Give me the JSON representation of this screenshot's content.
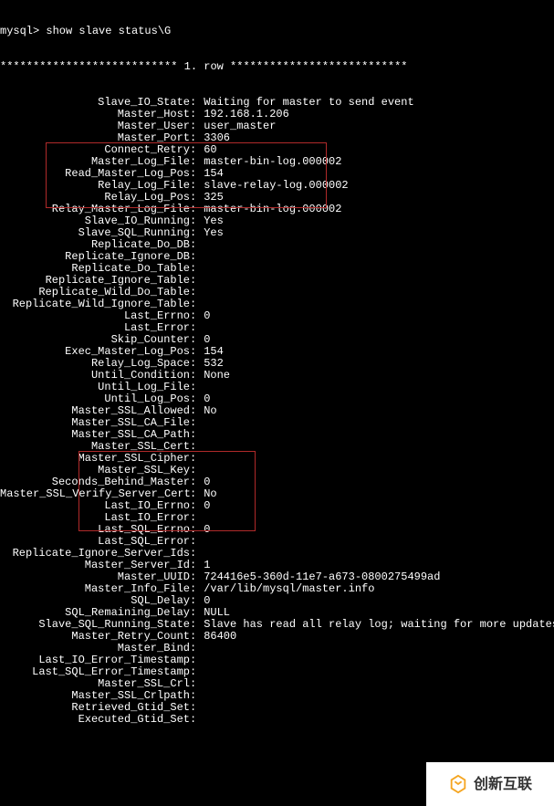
{
  "prompt": "mysql> show slave status\\G",
  "header": "*************************** 1. row ***************************",
  "rows": [
    {
      "label": "Slave_IO_State",
      "value": "Waiting for master to send event"
    },
    {
      "label": "Master_Host",
      "value": "192.168.1.206"
    },
    {
      "label": "Master_User",
      "value": "user_master"
    },
    {
      "label": "Master_Port",
      "value": "3306"
    },
    {
      "label": "Connect_Retry",
      "value": "60"
    },
    {
      "label": "Master_Log_File",
      "value": "master-bin-log.000002"
    },
    {
      "label": "Read_Master_Log_Pos",
      "value": "154"
    },
    {
      "label": "Relay_Log_File",
      "value": "slave-relay-log.000002"
    },
    {
      "label": "Relay_Log_Pos",
      "value": "325"
    },
    {
      "label": "Relay_Master_Log_File",
      "value": "master-bin-log.000002"
    },
    {
      "label": "Slave_IO_Running",
      "value": "Yes"
    },
    {
      "label": "Slave_SQL_Running",
      "value": "Yes"
    },
    {
      "label": "Replicate_Do_DB",
      "value": ""
    },
    {
      "label": "Replicate_Ignore_DB",
      "value": ""
    },
    {
      "label": "Replicate_Do_Table",
      "value": ""
    },
    {
      "label": "Replicate_Ignore_Table",
      "value": ""
    },
    {
      "label": "Replicate_Wild_Do_Table",
      "value": ""
    },
    {
      "label": "Replicate_Wild_Ignore_Table",
      "value": ""
    },
    {
      "label": "Last_Errno",
      "value": "0"
    },
    {
      "label": "Last_Error",
      "value": ""
    },
    {
      "label": "Skip_Counter",
      "value": "0"
    },
    {
      "label": "Exec_Master_Log_Pos",
      "value": "154"
    },
    {
      "label": "Relay_Log_Space",
      "value": "532"
    },
    {
      "label": "Until_Condition",
      "value": "None"
    },
    {
      "label": "Until_Log_File",
      "value": ""
    },
    {
      "label": "Until_Log_Pos",
      "value": "0"
    },
    {
      "label": "Master_SSL_Allowed",
      "value": "No"
    },
    {
      "label": "Master_SSL_CA_File",
      "value": ""
    },
    {
      "label": "Master_SSL_CA_Path",
      "value": ""
    },
    {
      "label": "Master_SSL_Cert",
      "value": ""
    },
    {
      "label": "Master_SSL_Cipher",
      "value": ""
    },
    {
      "label": "Master_SSL_Key",
      "value": ""
    },
    {
      "label": "Seconds_Behind_Master",
      "value": "0"
    },
    {
      "label": "Master_SSL_Verify_Server_Cert",
      "value": "No"
    },
    {
      "label": "Last_IO_Errno",
      "value": "0"
    },
    {
      "label": "Last_IO_Error",
      "value": ""
    },
    {
      "label": "Last_SQL_Errno",
      "value": "0"
    },
    {
      "label": "Last_SQL_Error",
      "value": ""
    },
    {
      "label": "Replicate_Ignore_Server_Ids",
      "value": ""
    },
    {
      "label": "Master_Server_Id",
      "value": "1"
    },
    {
      "label": "Master_UUID",
      "value": "724416e5-360d-11e7-a673-0800275499ad"
    },
    {
      "label": "Master_Info_File",
      "value": "/var/lib/mysql/master.info"
    },
    {
      "label": "SQL_Delay",
      "value": "0"
    },
    {
      "label": "SQL_Remaining_Delay",
      "value": "NULL"
    },
    {
      "label": "Slave_SQL_Running_State",
      "value": "Slave has read all relay log; waiting for more updates"
    },
    {
      "label": "Master_Retry_Count",
      "value": "86400"
    },
    {
      "label": "Master_Bind",
      "value": ""
    },
    {
      "label": "Last_IO_Error_Timestamp",
      "value": ""
    },
    {
      "label": "Last_SQL_Error_Timestamp",
      "value": ""
    },
    {
      "label": "Master_SSL_Crl",
      "value": ""
    },
    {
      "label": "Master_SSL_Crlpath",
      "value": ""
    },
    {
      "label": "Retrieved_Gtid_Set",
      "value": ""
    },
    {
      "label": "Executed_Gtid_Set",
      "value": ""
    }
  ],
  "watermark_text": "创新互联"
}
